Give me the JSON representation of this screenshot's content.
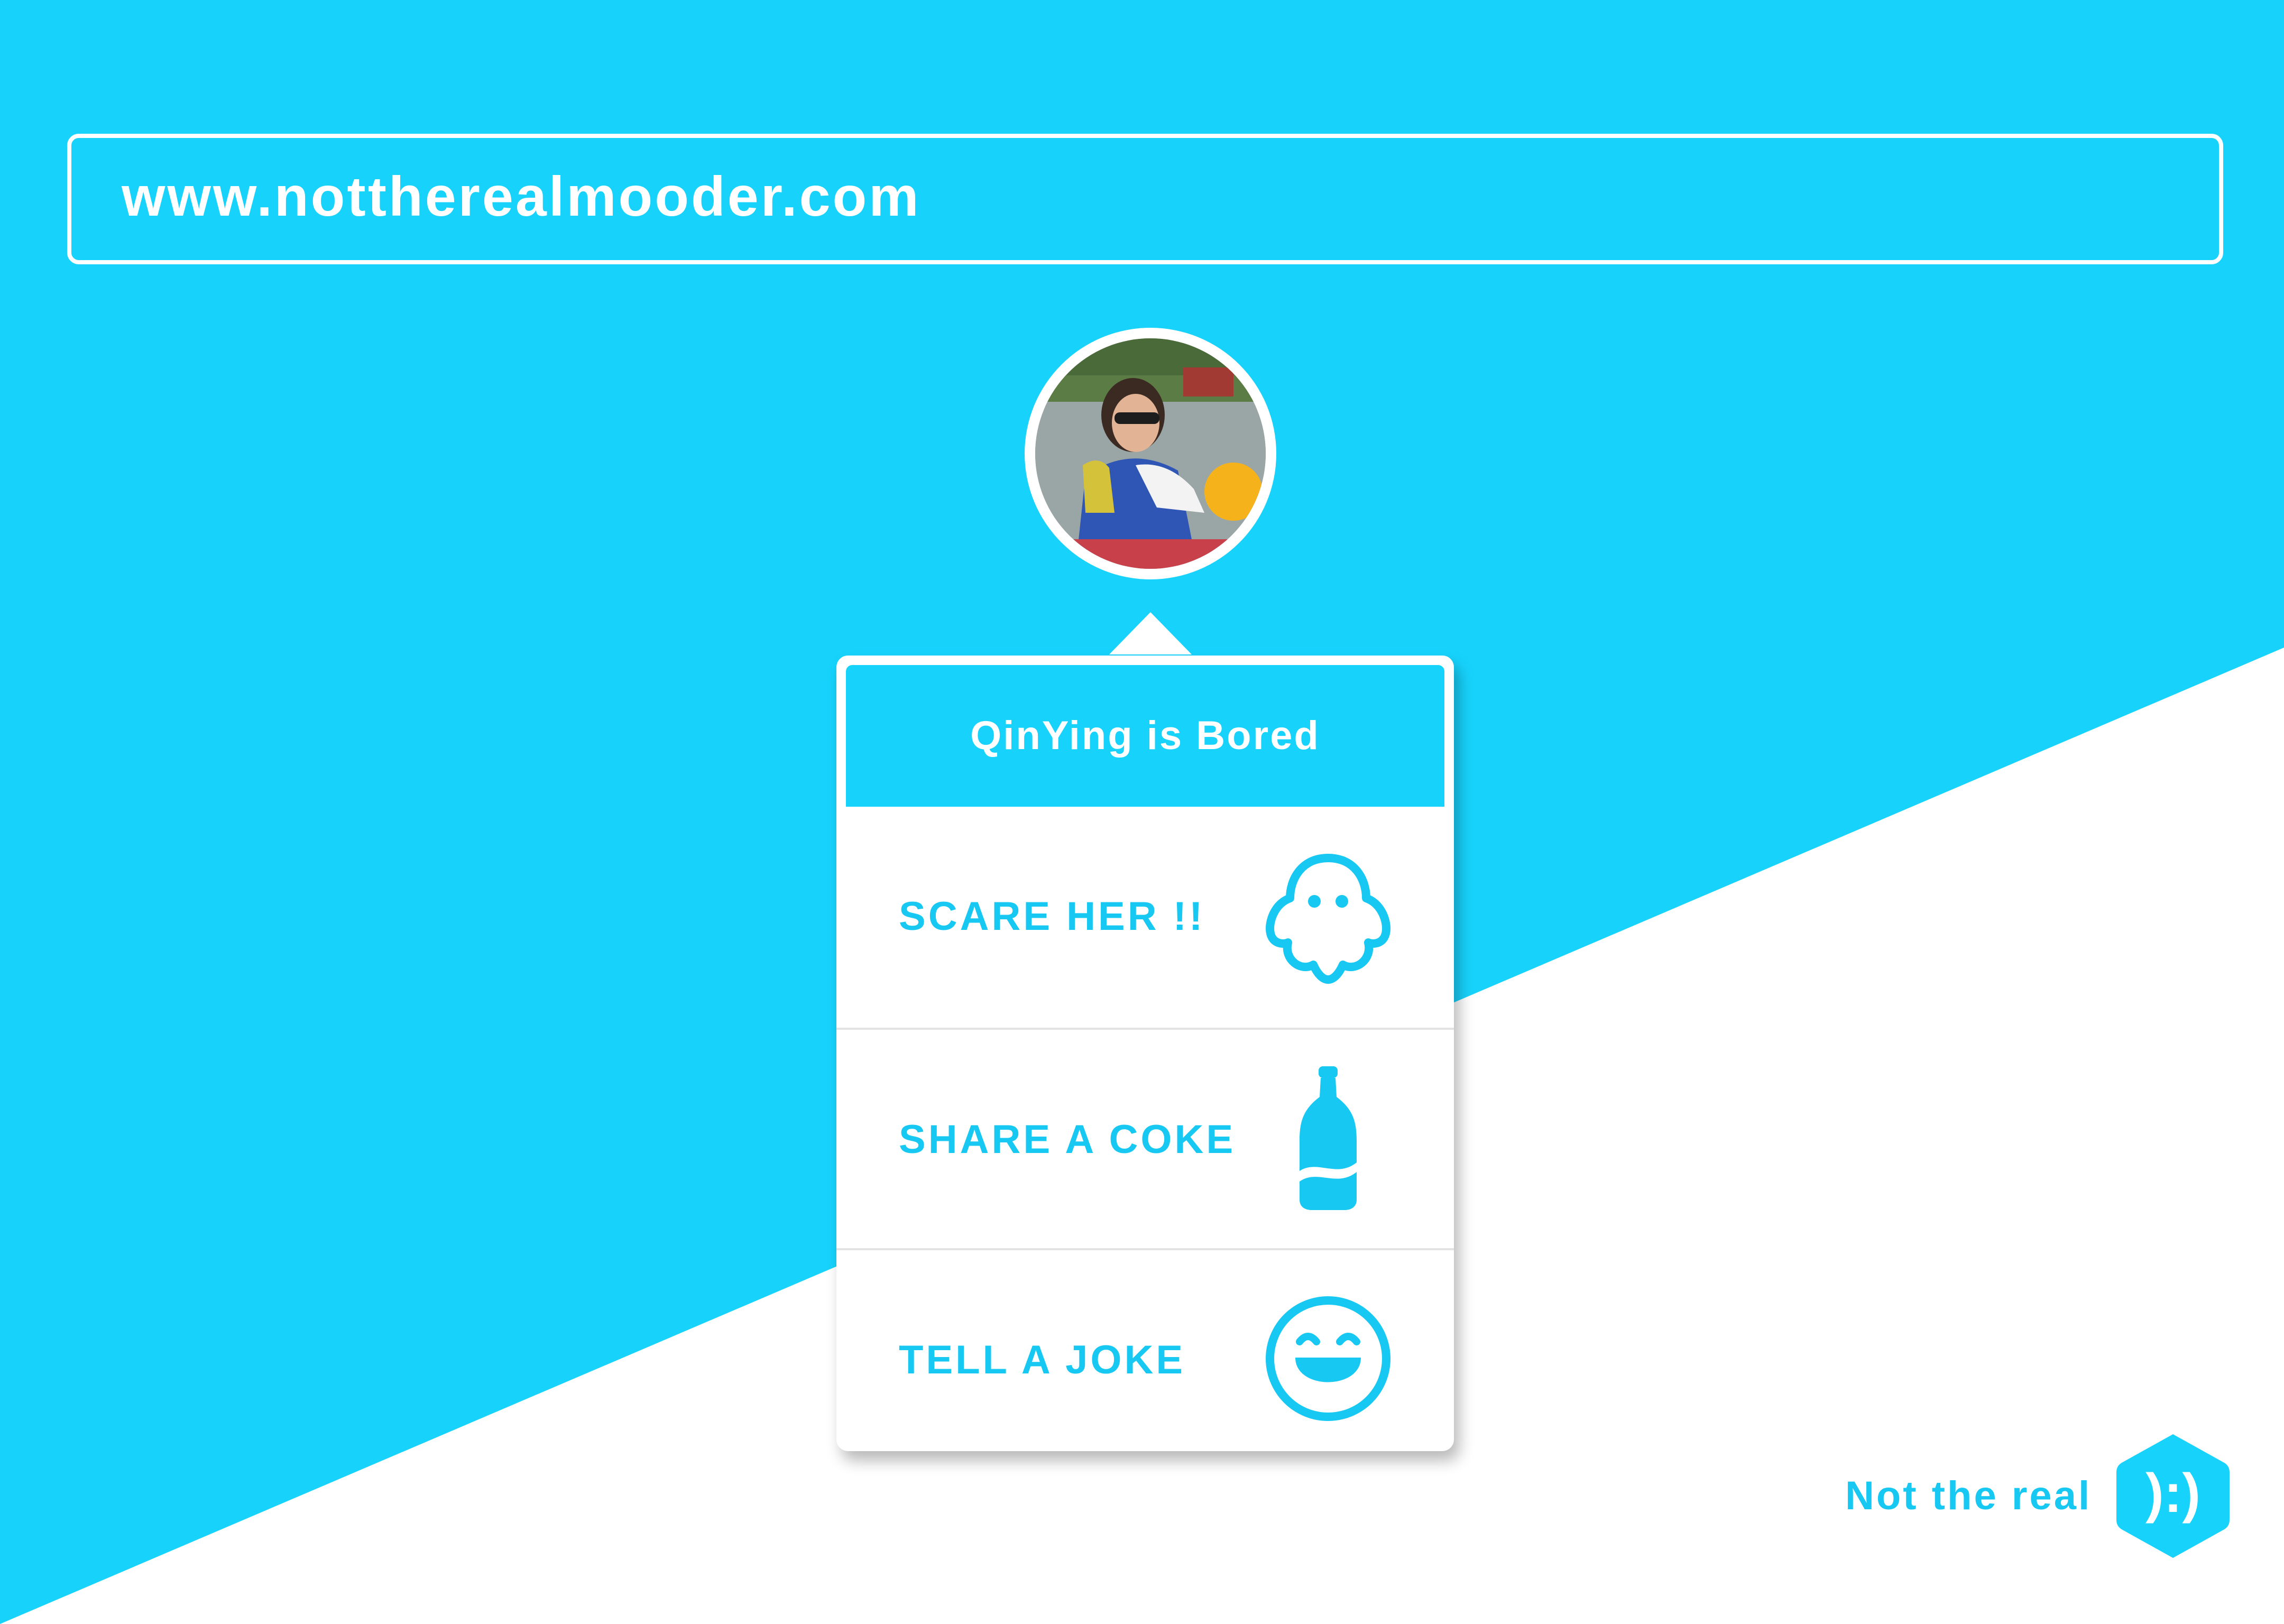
{
  "browser": {
    "url": "www.nottherealmooder.com"
  },
  "profile": {
    "name": "QinYing",
    "mood_title": "QinYing is Bored",
    "avatar_alt": "avatar-photo"
  },
  "actions": [
    {
      "label": "SCARE HER !!",
      "icon": "ghost-icon"
    },
    {
      "label": "SHARE A COKE",
      "icon": "coke-bottle-icon"
    },
    {
      "label": "TELL A JOKE",
      "icon": "laughing-face-icon"
    }
  ],
  "brand": {
    "text": "Not the real",
    "logo": "hexagon-mood-logo",
    "logo_glyph": "):)"
  },
  "colors": {
    "accent": "#17d3fc",
    "accent_text": "#17c8f2",
    "background_light": "#ffffff"
  }
}
